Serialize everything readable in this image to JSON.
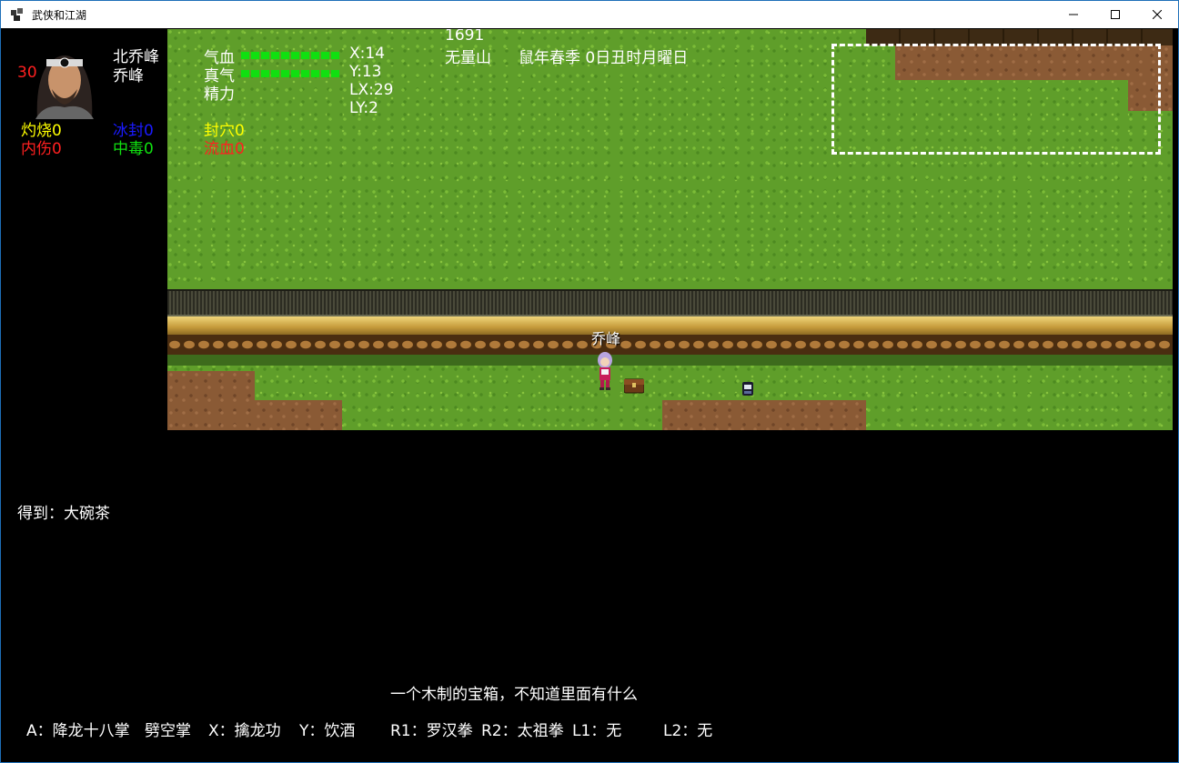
{
  "window": {
    "title": "武侠和江湖",
    "controls": [
      "minimize",
      "maximize",
      "close"
    ]
  },
  "hud": {
    "level": "30",
    "name_title": "北乔峰",
    "name": "乔峰",
    "status": {
      "burn": "灼烧0",
      "freeze": "冰封0",
      "seal": "封穴0",
      "internal_injury": "内伤0",
      "poison": "中毒0",
      "bleed": "流血0"
    },
    "bars": [
      {
        "label": "气血",
        "fill": 1.0
      },
      {
        "label": "真气",
        "fill": 1.0
      },
      {
        "label": "精力",
        "fill": 0.0
      }
    ],
    "coords": {
      "x": "X:14",
      "y": "Y:13",
      "lx": "LX:29",
      "ly": "LY:2"
    },
    "year": "1691",
    "location": "无量山",
    "date": "鼠年春季 0日丑时月曜日"
  },
  "map": {
    "character_label": "乔峰"
  },
  "messages": {
    "obtained": "得到：大碗茶",
    "description": "一个木制的宝箱，不知道里面有什么"
  },
  "keybinds": {
    "a": "A：降龙十八掌",
    "b": "劈空掌",
    "x": "X：擒龙功",
    "y": "Y：饮酒",
    "r1": "R1：罗汉拳",
    "r2": "R2：太祖拳",
    "l1": "L1：无",
    "l2": "L2：无"
  },
  "colors": {
    "burn": "#ffff00",
    "freeze": "#1a1aff",
    "seal": "#ffff00",
    "internal_injury": "#ff2020",
    "poison": "#10e010",
    "bleed": "#ff2020",
    "bars": "#10e010"
  }
}
